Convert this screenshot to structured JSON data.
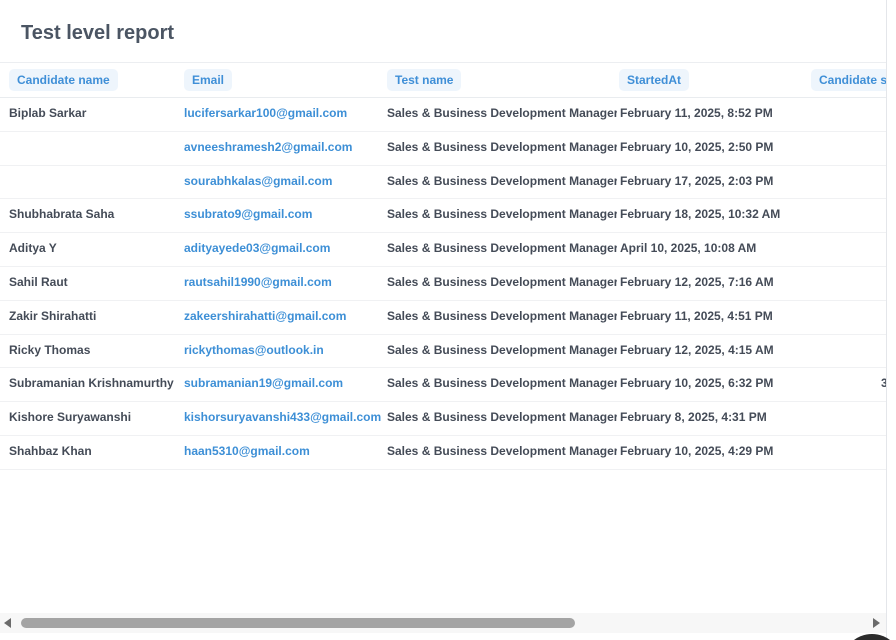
{
  "title": "Test level report",
  "columns": [
    "Candidate name",
    "Email",
    "Test name",
    "StartedAt",
    "Candidate sc"
  ],
  "rows": [
    {
      "name": "Biplab Sarkar",
      "email": "lucifersarkar100@gmail.com",
      "test": "Sales & Business Development Manager",
      "started": "February 11, 2025, 8:52 PM",
      "score": ""
    },
    {
      "name": "",
      "email": "avneeshramesh2@gmail.com",
      "test": "Sales & Business Development Manager",
      "started": "February 10, 2025, 2:50 PM",
      "score": ""
    },
    {
      "name": "",
      "email": "sourabhkalas@gmail.com",
      "test": "Sales & Business Development Manager",
      "started": "February 17, 2025, 2:03 PM",
      "score": ""
    },
    {
      "name": "Shubhabrata Saha",
      "email": "ssubrato9@gmail.com",
      "test": "Sales & Business Development Manager",
      "started": "February 18, 2025, 10:32 AM",
      "score": ""
    },
    {
      "name": "Aditya Y",
      "email": "adityayede03@gmail.com",
      "test": "Sales & Business Development Manager",
      "started": "April 10, 2025, 10:08 AM",
      "score": ""
    },
    {
      "name": "Sahil Raut",
      "email": "rautsahil1990@gmail.com",
      "test": "Sales & Business Development Manager",
      "started": "February 12, 2025, 7:16 AM",
      "score": ""
    },
    {
      "name": "Zakir Shirahatti",
      "email": "zakeershirahatti@gmail.com",
      "test": "Sales & Business Development Manager",
      "started": "February 11, 2025, 4:51 PM",
      "score": ""
    },
    {
      "name": "Ricky Thomas",
      "email": "rickythomas@outlook.in",
      "test": "Sales & Business Development Manager",
      "started": "February 12, 2025, 4:15 AM",
      "score": ""
    },
    {
      "name": "Subramanian Krishnamurthy",
      "email": "subramanian19@gmail.com",
      "test": "Sales & Business Development Manager",
      "started": "February 10, 2025, 6:32 PM",
      "score": "3"
    },
    {
      "name": "Kishore Suryawanshi",
      "email": "kishorsuryavanshi433@gmail.com",
      "test": "Sales & Business Development Manager",
      "started": "February 8, 2025, 4:31 PM",
      "score": ""
    },
    {
      "name": "Shahbaz Khan",
      "email": "haan5310@gmail.com",
      "test": "Sales & Business Development Manager",
      "started": "February 10, 2025, 4:29 PM",
      "score": ""
    }
  ],
  "scrollbar": {
    "left_icon": "arrow-left-icon",
    "right_icon": "arrow-right-icon"
  },
  "colors": {
    "header_text": "#3f8fd7",
    "header_bg": "#eef5fc",
    "email": "#3d8fd6",
    "title": "#4b5563"
  }
}
